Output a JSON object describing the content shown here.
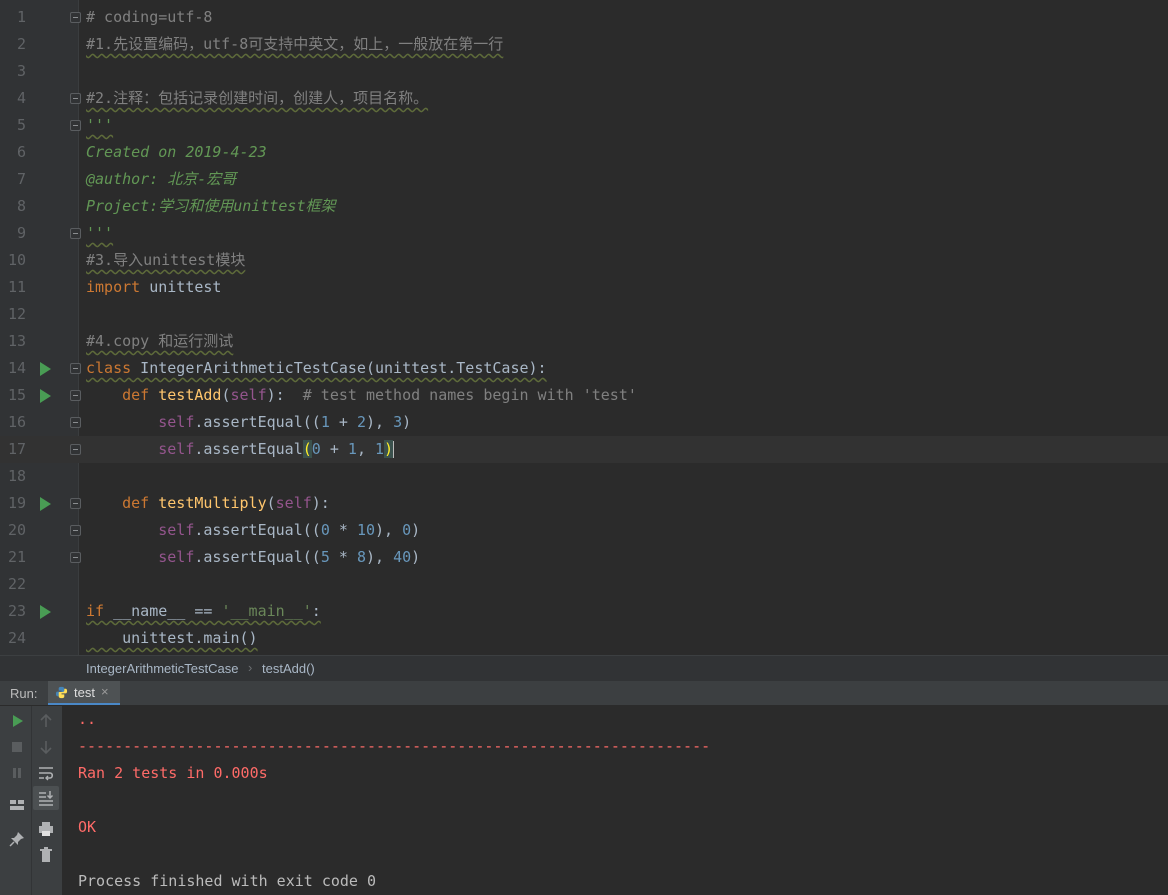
{
  "editor": {
    "lines": [
      {
        "n": "1",
        "tokens": [
          {
            "t": "# coding=utf-8",
            "c": "c-comment"
          }
        ]
      },
      {
        "n": "2",
        "tokens": [
          {
            "t": "#1.先设置编码，utf-8可支持中英文，如上，一般放在第一行",
            "c": "c-comment squiggle"
          }
        ]
      },
      {
        "n": "3",
        "tokens": []
      },
      {
        "n": "4",
        "tokens": [
          {
            "t": "#2.注释：包括记录创建时间，创建人，项目名称。",
            "c": "c-comment squiggle"
          }
        ]
      },
      {
        "n": "5",
        "tokens": [
          {
            "t": "'''",
            "c": "c-doc squiggle"
          }
        ]
      },
      {
        "n": "6",
        "tokens": [
          {
            "t": "Created on 2019-4-23",
            "c": "c-doc"
          }
        ]
      },
      {
        "n": "7",
        "tokens": [
          {
            "t": "@author: 北京-宏哥",
            "c": "c-doc"
          }
        ]
      },
      {
        "n": "8",
        "tokens": [
          {
            "t": "Project:学习和使用unittest框架",
            "c": "c-doc"
          }
        ]
      },
      {
        "n": "9",
        "tokens": [
          {
            "t": "'''",
            "c": "c-doc squiggle"
          }
        ]
      },
      {
        "n": "10",
        "tokens": [
          {
            "t": "#3.导入unittest模块",
            "c": "c-comment squiggle"
          }
        ]
      },
      {
        "n": "11",
        "tokens": [
          {
            "t": "import",
            "c": "c-kw"
          },
          {
            "t": " unittest",
            "c": ""
          }
        ]
      },
      {
        "n": "12",
        "tokens": []
      },
      {
        "n": "13",
        "tokens": [
          {
            "t": "#4.copy 和运行测试",
            "c": "c-comment squiggle"
          }
        ]
      },
      {
        "n": "14",
        "tokens": [
          {
            "t": "class",
            "c": "c-kw squiggle"
          },
          {
            "t": " IntegerArithmeticTestCase(unittest.TestCase):",
            "c": "squiggle"
          }
        ]
      },
      {
        "n": "15",
        "tokens": [
          {
            "t": "    ",
            "c": ""
          },
          {
            "t": "def",
            "c": "c-kw"
          },
          {
            "t": " ",
            "c": ""
          },
          {
            "t": "testAdd",
            "c": "c-fn"
          },
          {
            "t": "(",
            "c": ""
          },
          {
            "t": "self",
            "c": "c-self"
          },
          {
            "t": "):  ",
            "c": ""
          },
          {
            "t": "# test method names begin with 'test'",
            "c": "c-comment"
          }
        ]
      },
      {
        "n": "16",
        "tokens": [
          {
            "t": "        ",
            "c": ""
          },
          {
            "t": "self",
            "c": "c-self"
          },
          {
            "t": ".assertEqual((",
            "c": ""
          },
          {
            "t": "1",
            "c": "c-num"
          },
          {
            "t": " + ",
            "c": ""
          },
          {
            "t": "2",
            "c": "c-num"
          },
          {
            "t": "), ",
            "c": ""
          },
          {
            "t": "3",
            "c": "c-num"
          },
          {
            "t": ")",
            "c": ""
          }
        ]
      },
      {
        "n": "17",
        "current": true,
        "tokens": [
          {
            "t": "        ",
            "c": ""
          },
          {
            "t": "self",
            "c": "c-self"
          },
          {
            "t": ".assertEqual",
            "c": ""
          },
          {
            "t": "(",
            "c": "c-paren-match"
          },
          {
            "t": "0",
            "c": "c-num"
          },
          {
            "t": " + ",
            "c": ""
          },
          {
            "t": "1",
            "c": "c-num"
          },
          {
            "t": ", ",
            "c": ""
          },
          {
            "t": "1",
            "c": "c-num"
          },
          {
            "t": ")",
            "c": "c-paren-match"
          }
        ]
      },
      {
        "n": "18",
        "tokens": []
      },
      {
        "n": "19",
        "tokens": [
          {
            "t": "    ",
            "c": ""
          },
          {
            "t": "def",
            "c": "c-kw"
          },
          {
            "t": " ",
            "c": ""
          },
          {
            "t": "testMultiply",
            "c": "c-fn"
          },
          {
            "t": "(",
            "c": ""
          },
          {
            "t": "self",
            "c": "c-self"
          },
          {
            "t": "):",
            "c": ""
          }
        ]
      },
      {
        "n": "20",
        "tokens": [
          {
            "t": "        ",
            "c": ""
          },
          {
            "t": "self",
            "c": "c-self"
          },
          {
            "t": ".assertEqual((",
            "c": ""
          },
          {
            "t": "0",
            "c": "c-num"
          },
          {
            "t": " * ",
            "c": ""
          },
          {
            "t": "10",
            "c": "c-num"
          },
          {
            "t": "), ",
            "c": ""
          },
          {
            "t": "0",
            "c": "c-num"
          },
          {
            "t": ")",
            "c": ""
          }
        ]
      },
      {
        "n": "21",
        "tokens": [
          {
            "t": "        ",
            "c": ""
          },
          {
            "t": "self",
            "c": "c-self"
          },
          {
            "t": ".assertEqual((",
            "c": ""
          },
          {
            "t": "5",
            "c": "c-num"
          },
          {
            "t": " * ",
            "c": ""
          },
          {
            "t": "8",
            "c": "c-num"
          },
          {
            "t": "), ",
            "c": ""
          },
          {
            "t": "40",
            "c": "c-num"
          },
          {
            "t": ")",
            "c": ""
          }
        ]
      },
      {
        "n": "22",
        "tokens": []
      },
      {
        "n": "23",
        "tokens": [
          {
            "t": "if",
            "c": "c-kw squiggle"
          },
          {
            "t": " __name__ == ",
            "c": "squiggle"
          },
          {
            "t": "'__main__'",
            "c": "c-str squiggle"
          },
          {
            "t": ":",
            "c": "squiggle"
          }
        ]
      },
      {
        "n": "24",
        "tokens": [
          {
            "t": "    unittest.main()",
            "c": "squiggle"
          }
        ]
      }
    ],
    "run_gutter_lines": [
      "14",
      "15",
      "19",
      "23"
    ],
    "fold_lines": [
      "1",
      "4",
      "5",
      "9",
      "14",
      "15",
      "16",
      "17",
      "19",
      "20",
      "21"
    ]
  },
  "breadcrumb": {
    "items": [
      "IntegerArithmeticTestCase",
      "testAdd()"
    ],
    "separator": "›"
  },
  "run_panel": {
    "label": "Run:",
    "tab_label": "test",
    "close_glyph": "×",
    "console": [
      {
        "text": "..",
        "kind": "err"
      },
      {
        "text": "----------------------------------------------------------------------",
        "kind": "err"
      },
      {
        "text": "Ran 2 tests in 0.000s",
        "kind": "err"
      },
      {
        "text": "",
        "kind": "err"
      },
      {
        "text": "OK",
        "kind": "err"
      },
      {
        "text": "",
        "kind": "normal"
      },
      {
        "text": "Process finished with exit code 0",
        "kind": "normal"
      }
    ]
  },
  "colors": {
    "background": "#2b2b2b",
    "gutter": "#313335",
    "keyword": "#cc7832",
    "function": "#ffc66d",
    "self": "#94558d",
    "number": "#6897bb",
    "docstring": "#629755",
    "comment": "#808080",
    "error_output": "#ff6b68",
    "run_green": "#499c54"
  }
}
